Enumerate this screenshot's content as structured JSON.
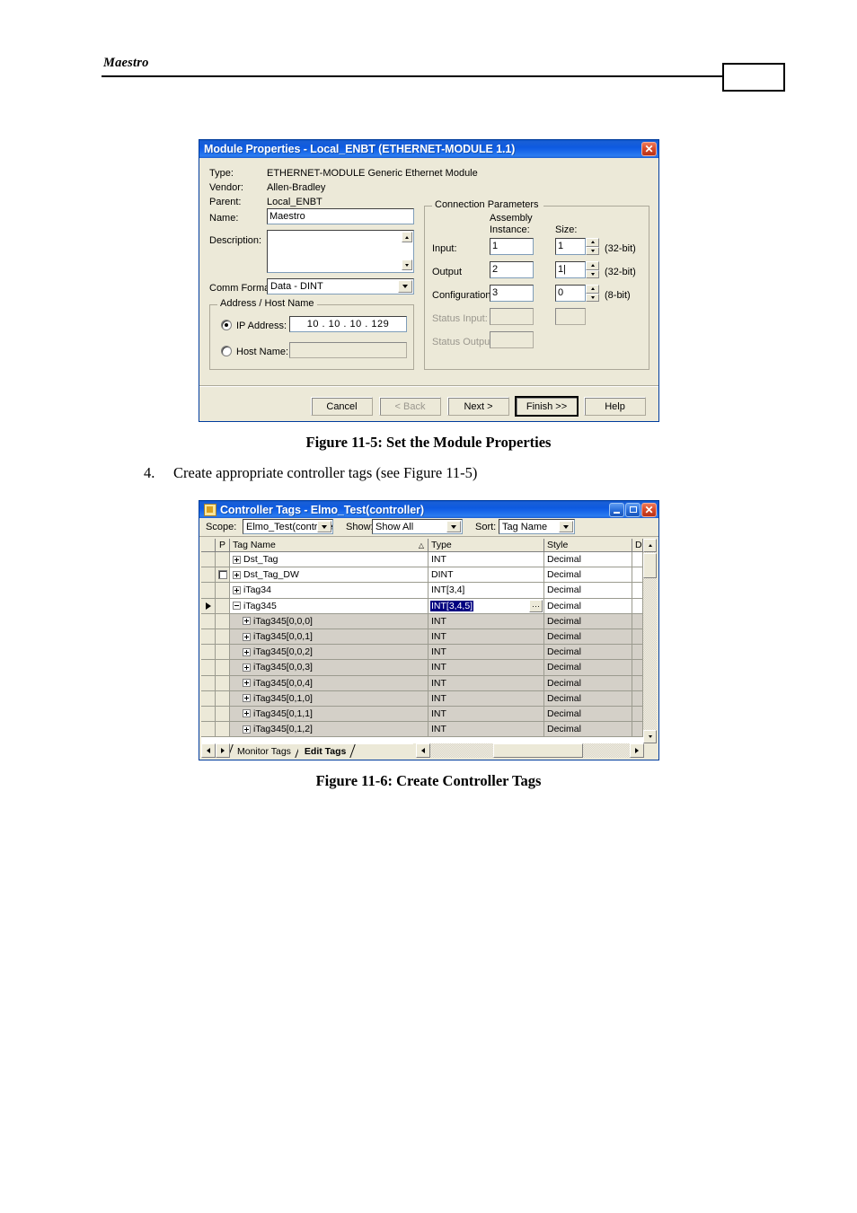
{
  "page": {
    "header_title": "Maestro"
  },
  "figure1": {
    "caption": "Figure 11-5: Set the Module Properties",
    "window": {
      "title": "Module Properties  - Local_ENBT (ETHERNET-MODULE 1.1)",
      "close_label": "✕"
    },
    "fields": {
      "type_label": "Type:",
      "type_value": "ETHERNET-MODULE Generic Ethernet Module",
      "vendor_label": "Vendor:",
      "vendor_value": "Allen-Bradley",
      "parent_label": "Parent:",
      "parent_value": "Local_ENBT",
      "name_label": "Name:",
      "name_value": "Maestro",
      "description_label": "Description:",
      "description_value": "",
      "comm_format_label": "Comm Format:",
      "comm_format_value": "Data - DINT"
    },
    "address_group": {
      "title": "Address / Host Name",
      "ip_label": "IP Address:",
      "ip_value": "10  .  10  .  10  . 129",
      "ip_selected": true,
      "host_label": "Host Name:",
      "host_value": ""
    },
    "connection_group": {
      "title": "Connection Parameters",
      "col_assembly_1": "Assembly",
      "col_assembly_2": "Instance:",
      "col_size": "Size:",
      "rows": [
        {
          "label": "Input:",
          "instance": "1",
          "size": "1",
          "unit": "(32-bit)",
          "enabled": true
        },
        {
          "label": "Output",
          "instance": "2",
          "size": "1|",
          "unit": "(32-bit)",
          "enabled": true
        },
        {
          "label": "Configuration:",
          "instance": "3",
          "size": "0",
          "unit": "(8-bit)",
          "enabled": true
        },
        {
          "label": "Status Input:",
          "instance": "",
          "size": "",
          "unit": "",
          "enabled": false
        },
        {
          "label": "Status Output:",
          "instance": "",
          "size": "",
          "unit": "",
          "enabled": false
        }
      ]
    },
    "buttons": [
      {
        "label": "Cancel",
        "state": "normal"
      },
      {
        "label": "< Back",
        "state": "disabled"
      },
      {
        "label": "Next >",
        "state": "normal"
      },
      {
        "label": "Finish >>",
        "state": "default"
      },
      {
        "label": "Help",
        "state": "normal"
      }
    ]
  },
  "step": {
    "number": "4.",
    "text": "Create appropriate controller tags (see Figure 11-5)"
  },
  "figure2": {
    "caption": "Figure 11-6: Create Controller Tags",
    "window": {
      "title": "Controller Tags - Elmo_Test(controller)",
      "minimize_label": "_",
      "maximize_label": "□",
      "close_label": "✕"
    },
    "toolbar": {
      "scope_label": "Scope:",
      "scope_value": "Elmo_Test(controller",
      "show_label": "Show:",
      "show_value": "Show All",
      "sort_label": "Sort:",
      "sort_value": "Tag Name"
    },
    "grid": {
      "headers": [
        "",
        "P",
        "Tag Name",
        "Type",
        "Style",
        "D"
      ],
      "sort_indicator": "△",
      "rows": [
        {
          "marker": false,
          "p": "",
          "name": "Dst_Tag",
          "indent": 0,
          "expander": "plus",
          "type": "INT",
          "style": "Decimal",
          "editing": false
        },
        {
          "marker": false,
          "p": "checkbox",
          "name": "Dst_Tag_DW",
          "indent": 0,
          "expander": "plus",
          "type": "DINT",
          "style": "Decimal",
          "editing": false
        },
        {
          "marker": false,
          "p": "",
          "name": "iTag34",
          "indent": 0,
          "expander": "plus",
          "type": "INT[3,4]",
          "style": "Decimal",
          "editing": false
        },
        {
          "marker": true,
          "p": "",
          "name": "iTag345",
          "indent": 0,
          "expander": "minus",
          "type": "INT[3,4,5]",
          "style": "Decimal",
          "editing": true
        },
        {
          "marker": false,
          "p": "",
          "name": "iTag345[0,0,0]",
          "indent": 1,
          "expander": "plus",
          "type": "INT",
          "style": "Decimal",
          "editing": false
        },
        {
          "marker": false,
          "p": "",
          "name": "iTag345[0,0,1]",
          "indent": 1,
          "expander": "plus",
          "type": "INT",
          "style": "Decimal",
          "editing": false
        },
        {
          "marker": false,
          "p": "",
          "name": "iTag345[0,0,2]",
          "indent": 1,
          "expander": "plus",
          "type": "INT",
          "style": "Decimal",
          "editing": false
        },
        {
          "marker": false,
          "p": "",
          "name": "iTag345[0,0,3]",
          "indent": 1,
          "expander": "plus",
          "type": "INT",
          "style": "Decimal",
          "editing": false
        },
        {
          "marker": false,
          "p": "",
          "name": "iTag345[0,0,4]",
          "indent": 1,
          "expander": "plus",
          "type": "INT",
          "style": "Decimal",
          "editing": false
        },
        {
          "marker": false,
          "p": "",
          "name": "iTag345[0,1,0]",
          "indent": 1,
          "expander": "plus",
          "type": "INT",
          "style": "Decimal",
          "editing": false
        },
        {
          "marker": false,
          "p": "",
          "name": "iTag345[0,1,1]",
          "indent": 1,
          "expander": "plus",
          "type": "INT",
          "style": "Decimal",
          "editing": false
        },
        {
          "marker": false,
          "p": "",
          "name": "iTag345[0,1,2]",
          "indent": 1,
          "expander": "plus",
          "type": "INT",
          "style": "Decimal",
          "editing": false
        }
      ],
      "edit_button_label": "···"
    },
    "sheet_tabs": [
      {
        "label": "Monitor Tags",
        "active": false
      },
      {
        "label": "Edit Tags",
        "active": true
      }
    ]
  }
}
